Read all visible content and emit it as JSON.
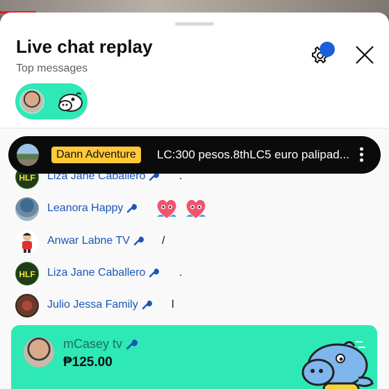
{
  "header": {
    "title": "Live chat replay",
    "subtitle": "Top messages"
  },
  "pinned": {
    "author": "Dann Adventure",
    "message": "LC:300 pesos.8thLC5 euro palipad..."
  },
  "messages": [
    {
      "author": "Liza Jane Caballero",
      "text": ".",
      "avatar": "HLF"
    },
    {
      "author": "Leanora Happy",
      "text": "",
      "emoji": "heart-face-emoji"
    },
    {
      "author": "Anwar Labne TV",
      "text": "/"
    },
    {
      "author": "Liza Jane Caballero",
      "text": ".",
      "avatar": "HLF"
    },
    {
      "author": "Julio Jessa Family",
      "text": "l"
    }
  ],
  "superchat": {
    "author": "mCasey tv",
    "amount": "₱125.00",
    "sticker": "hippo-sticker"
  },
  "colors": {
    "accent": "#2ee8b6",
    "author_blue": "#1a56b8",
    "badge_yellow": "#ffc937",
    "notification_blue": "#1a5fd6"
  },
  "icons": [
    "settings-icon",
    "close-icon",
    "wrench-icon",
    "more-vertical-icon"
  ]
}
